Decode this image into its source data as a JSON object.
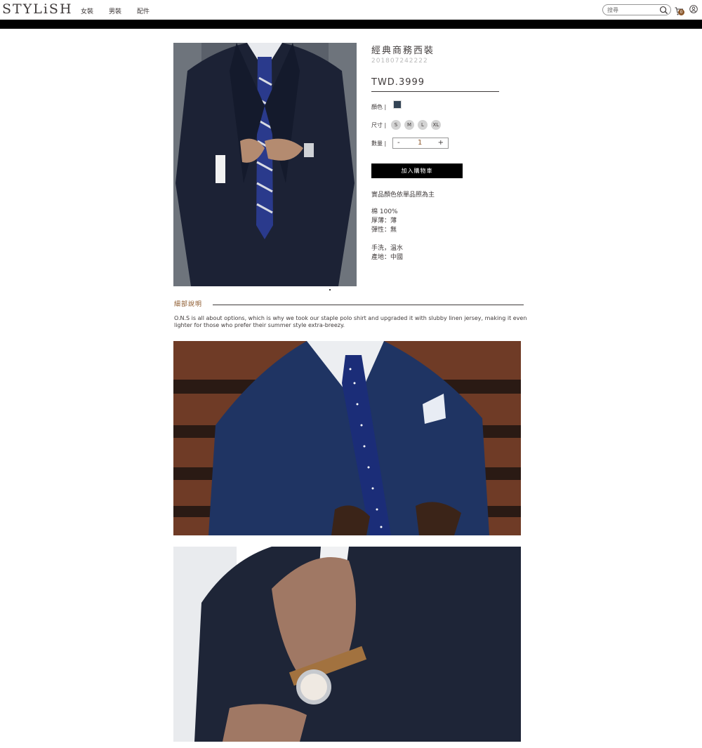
{
  "header": {
    "logo": "STYLiSH",
    "nav": [
      "女裝",
      "男裝",
      "配件"
    ],
    "search_placeholder": "搜尋",
    "cart_count": "0"
  },
  "product": {
    "title": "經典商務西裝",
    "id": "201807242222",
    "price": "TWD.3999",
    "color_label": "顏色 |",
    "color_hex": "#334455",
    "size_label": "尺寸 |",
    "sizes": [
      "S",
      "M",
      "L",
      "XL"
    ],
    "qty_label": "數量 |",
    "qty_minus": "-",
    "qty_value": "1",
    "qty_plus": "+",
    "add_to_cart": "加入購物車",
    "note": "實品顏色依單品照為主",
    "specs": [
      "棉 100%",
      "厚薄：薄",
      "彈性：無"
    ],
    "care": [
      "手洗，溫水",
      "產地：中國"
    ]
  },
  "details": {
    "title": "細部說明",
    "story": "O.N.S is all about options, which is why we took our staple polo shirt and upgraded it with slubby linen jersey, making it even lighter for those who prefer their summer style extra-breezy."
  },
  "colors": {
    "accent": "#8b572a",
    "text": "#3f3a3a",
    "bar": "#000000"
  }
}
